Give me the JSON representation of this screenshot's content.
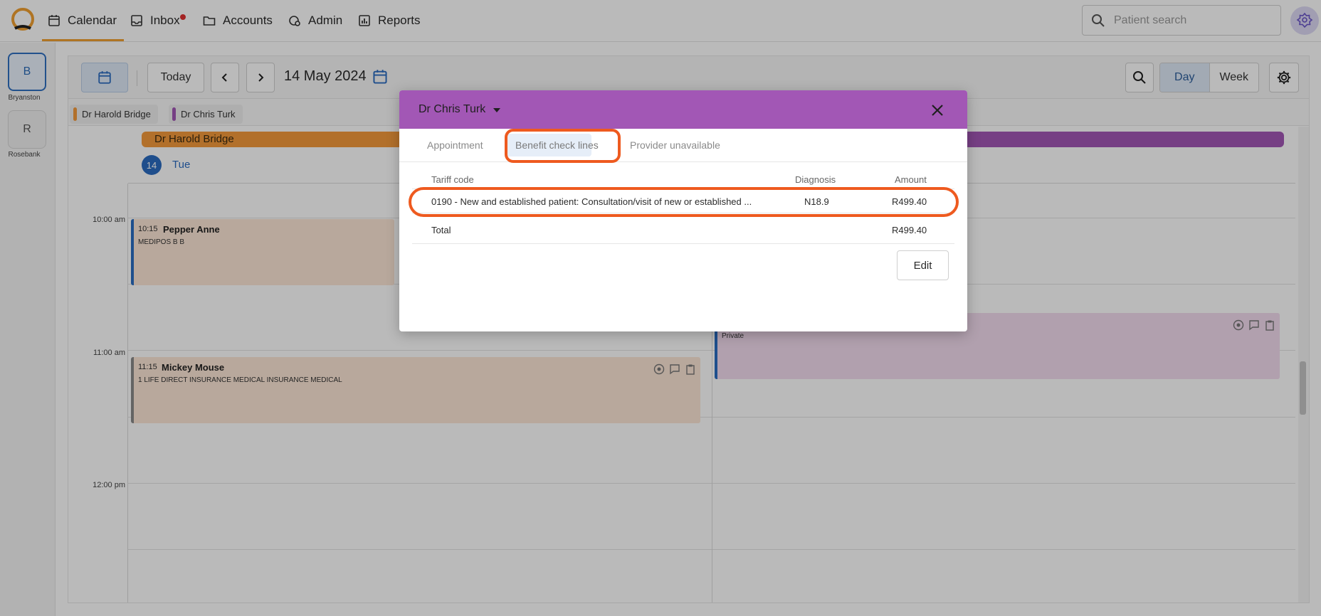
{
  "nav": {
    "calendar": "Calendar",
    "inbox": "Inbox",
    "accounts": "Accounts",
    "admin": "Admin",
    "reports": "Reports",
    "search_placeholder": "Patient search"
  },
  "sidebar": {
    "locations": [
      {
        "initial": "B",
        "label": "Bryanston"
      },
      {
        "initial": "R",
        "label": "Rosebank"
      }
    ]
  },
  "toolbar": {
    "today": "Today",
    "date": "14 May 2024",
    "views": [
      "Day",
      "Week"
    ]
  },
  "providers": [
    {
      "name": "Dr Harold Bridge",
      "color": "#f49a3c"
    },
    {
      "name": "Dr Chris Turk",
      "color": "#a257b5"
    }
  ],
  "day": {
    "number": "14",
    "name": "Tue"
  },
  "times": [
    "10:00 am",
    "11:00 am",
    "12:00 pm"
  ],
  "appointments": [
    {
      "time": "10:15",
      "name": "Pepper Anne",
      "details": "MEDIPOS B B"
    },
    {
      "time": "11:15",
      "name": "Mickey Mouse",
      "details": "1 LIFE DIRECT INSURANCE MEDICAL INSURANCE MEDICAL"
    },
    {
      "time": "",
      "name": "",
      "details": "Private"
    }
  ],
  "modal": {
    "provider": "Dr Chris Turk",
    "tabs": [
      "Appointment",
      "Benefit check lines",
      "Provider unavailable"
    ],
    "active_tab": "Benefit check lines",
    "columns": [
      "Tariff code",
      "Diagnosis",
      "Amount"
    ],
    "lines": [
      {
        "tariff": "0190 - New and established patient: Consultation/visit of new or established ...",
        "diagnosis": "N18.9",
        "amount": "R499.40"
      }
    ],
    "total_label": "Total",
    "total_amount": "R499.40",
    "edit": "Edit"
  },
  "colors": {
    "accent": "#2b6cc0",
    "highlight": "#ee5a1f",
    "modal_header": "#a257b5"
  }
}
